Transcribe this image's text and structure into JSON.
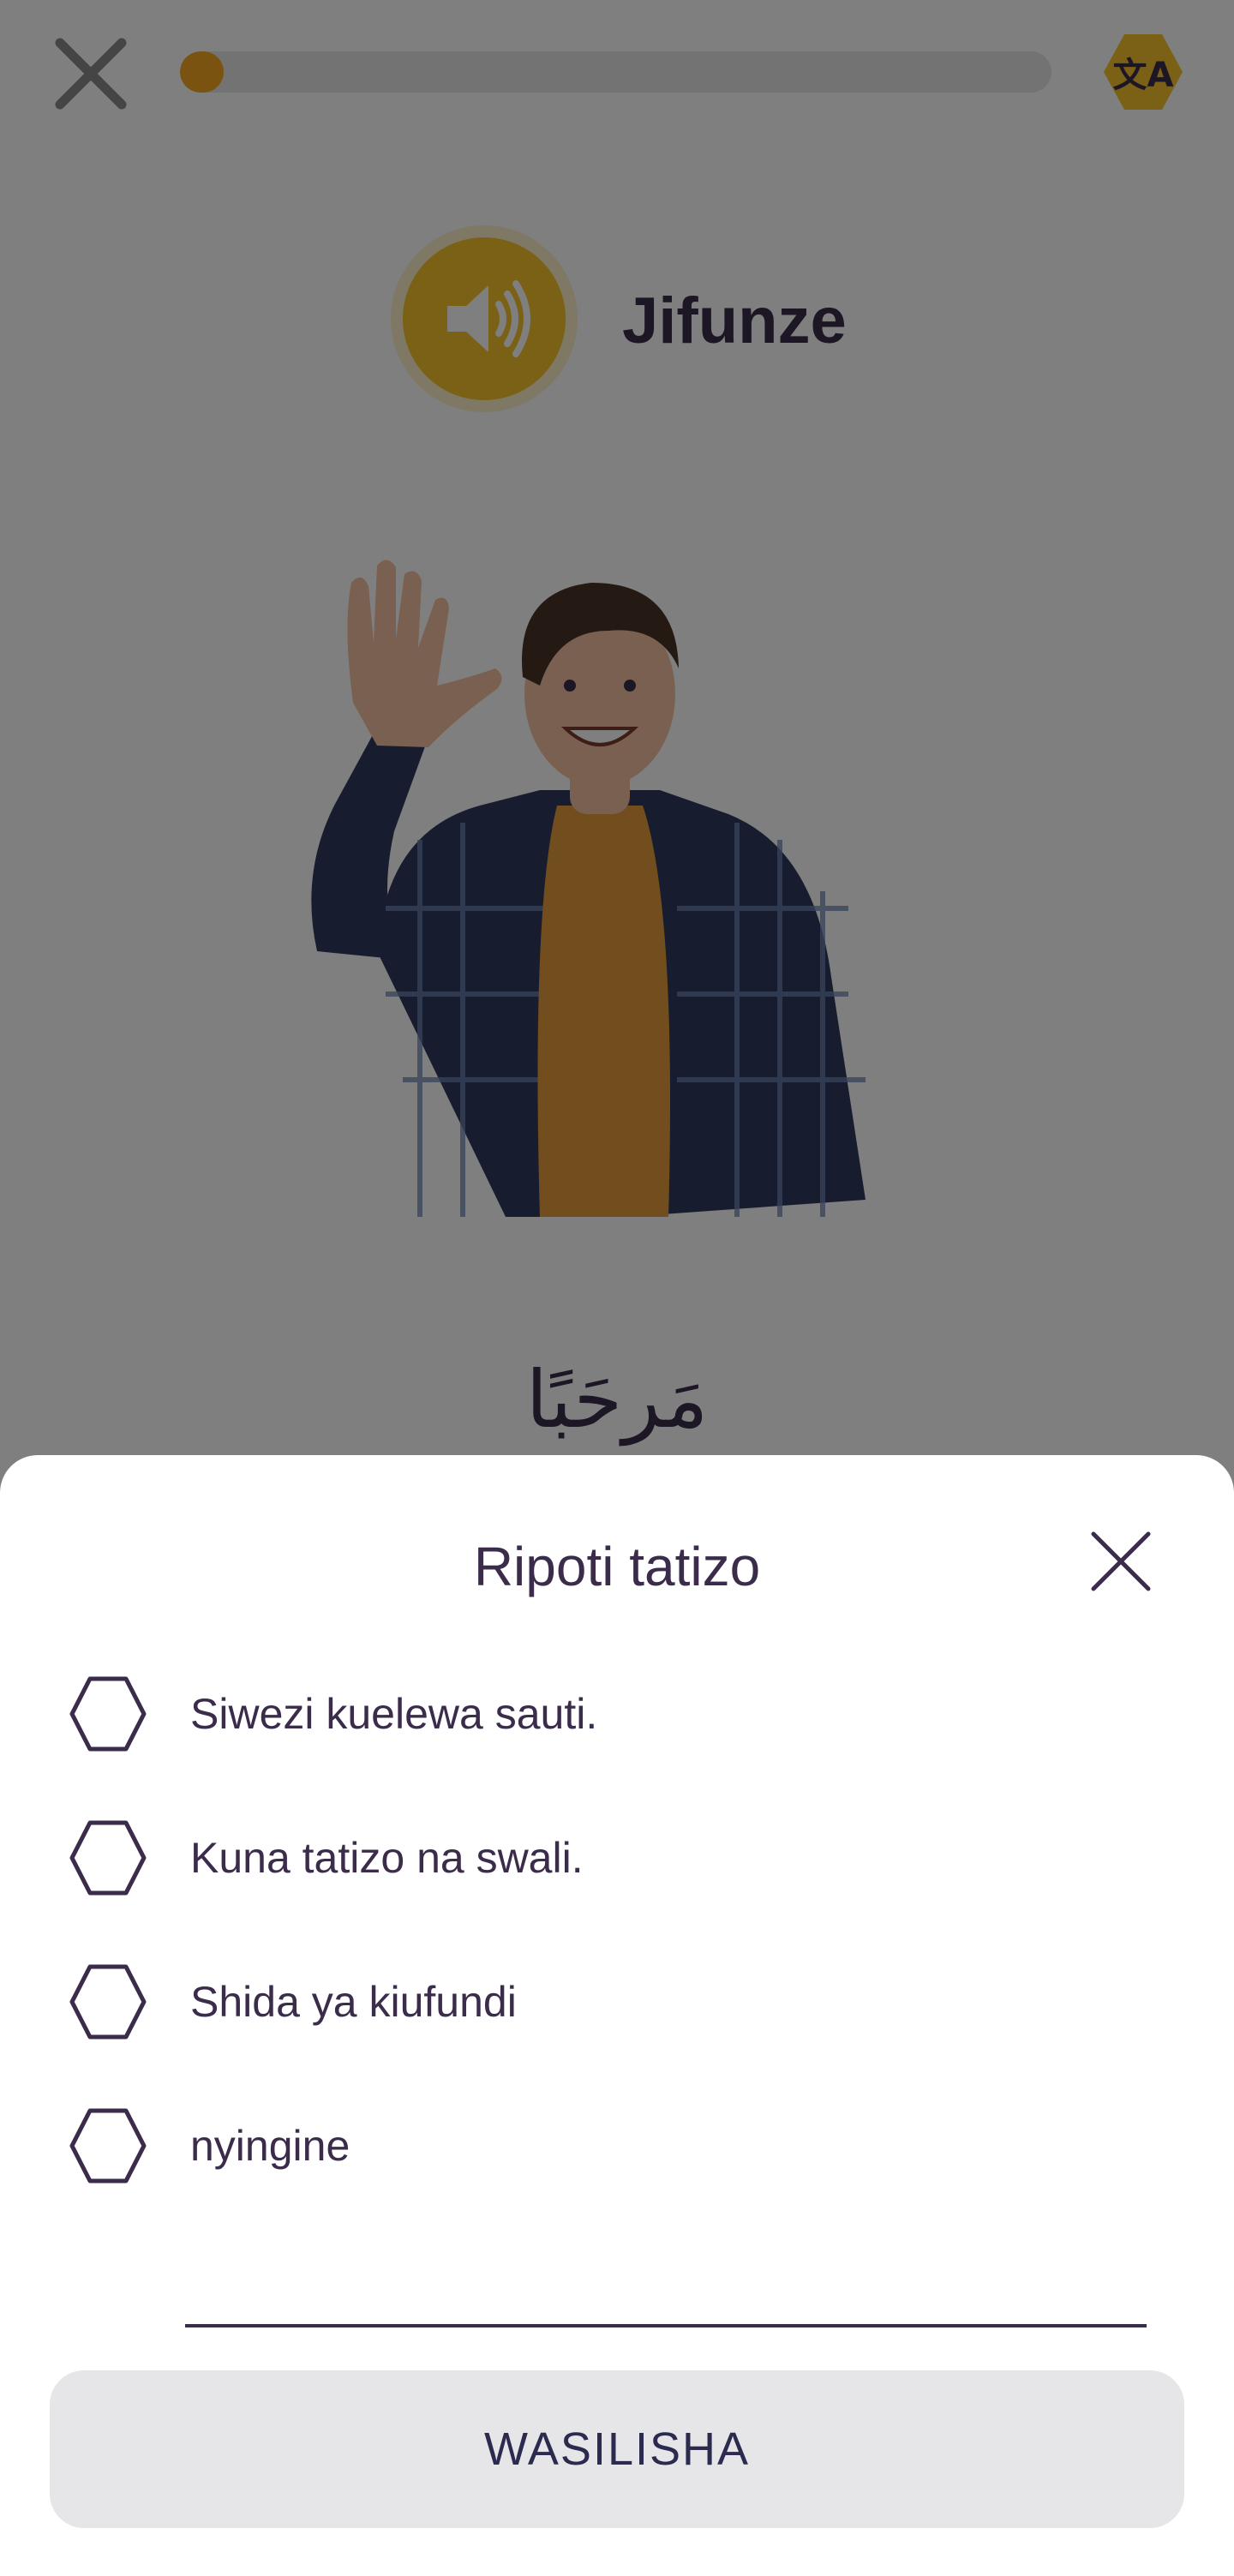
{
  "lesson": {
    "title": "Jifunze",
    "progress_fraction": 0.05,
    "word_arabic": "مَرحَبًا",
    "icons": {
      "close": "close-icon",
      "translate": "translate-icon",
      "audio": "speaker-icon"
    },
    "colors": {
      "accent": "#f4c22b",
      "progress": "#f5a623",
      "text": "#3a2c4a"
    }
  },
  "report_sheet": {
    "title": "Ripoti tatizo",
    "options": [
      {
        "label": "Siwezi kuelewa sauti."
      },
      {
        "label": "Kuna tatizo na swali."
      },
      {
        "label": "Shida ya kiufundi"
      },
      {
        "label": "nyingine"
      }
    ],
    "other_input": {
      "value": "",
      "placeholder": ""
    },
    "submit_label": "WASILISHA",
    "colors": {
      "text": "#3a2c4a",
      "button_bg": "#e6e6e8",
      "button_text": "#2b2a4f"
    }
  }
}
